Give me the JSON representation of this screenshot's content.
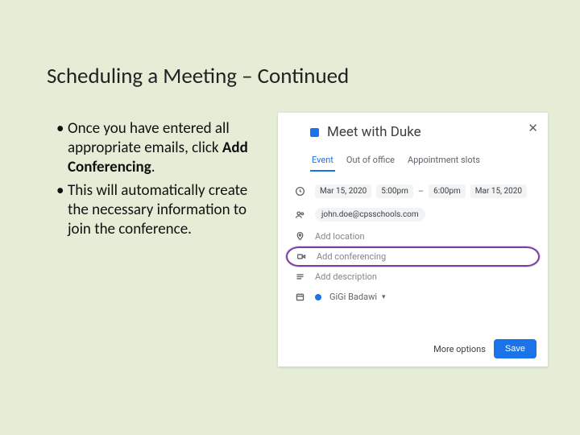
{
  "slide": {
    "title": "Scheduling a Meeting – Continued",
    "bullets": [
      {
        "pre": "Once you have entered all appropriate emails, click ",
        "bold": "Add Conferencing",
        "post": "."
      },
      {
        "pre": "This will automatically create the necessary information to join the conference.",
        "bold": "",
        "post": ""
      }
    ]
  },
  "panel": {
    "title": "Meet with Duke",
    "tabs": {
      "event": "Event",
      "ooo": "Out of office",
      "slots": "Appointment slots"
    },
    "date1": "Mar 15, 2020",
    "time1": "5:00pm",
    "dash": "–",
    "time2": "6:00pm",
    "date2": "Mar 15, 2020",
    "guest": "john.doe@cpsschools.com",
    "location_ph": "Add location",
    "conferencing_ph": "Add conferencing",
    "description_ph": "Add description",
    "calendar_name": "GiGi Badawi",
    "more": "More options",
    "save": "Save"
  }
}
